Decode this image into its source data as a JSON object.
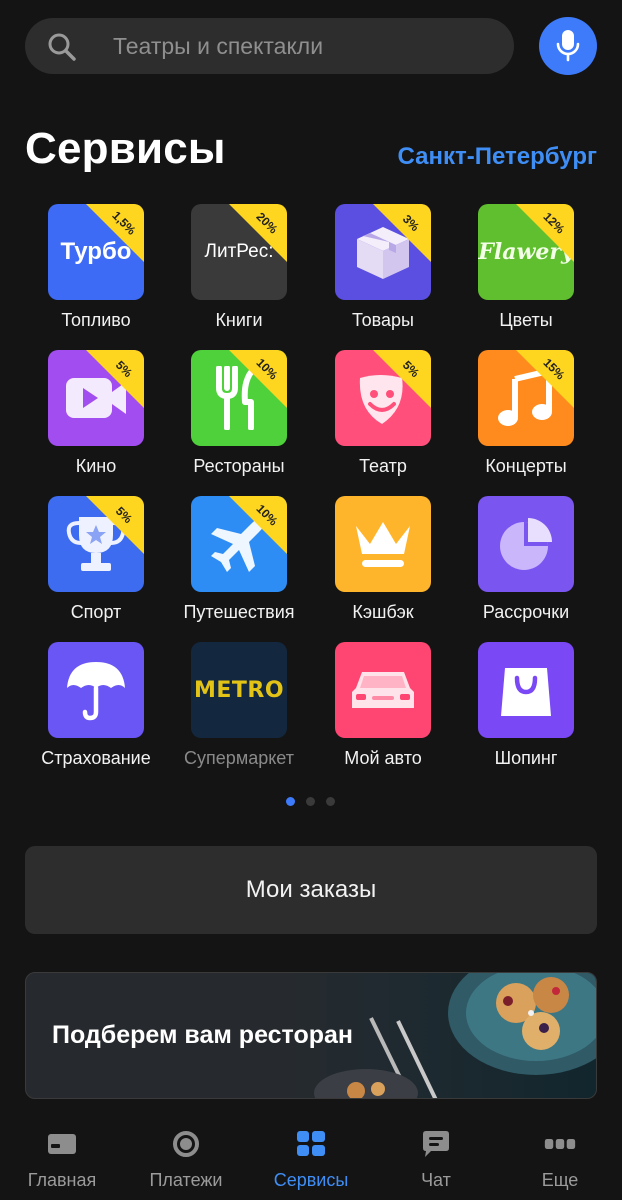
{
  "search": {
    "placeholder": "Театры и спектакли"
  },
  "header": {
    "title": "Сервисы",
    "city": "Санкт-Петербург"
  },
  "services": [
    {
      "label": "Топливо",
      "badge": "1,5%",
      "logo": "Турбо",
      "icon": "turbo-logo-icon",
      "color": "#3e6bf5"
    },
    {
      "label": "Книги",
      "badge": "20%",
      "logo": "ЛитРес:",
      "icon": "litres-logo-icon",
      "color": "#3a3a3a"
    },
    {
      "label": "Товары",
      "badge": "3%",
      "icon": "box-icon",
      "color": "#5a4fe0"
    },
    {
      "label": "Цветы",
      "badge": "12%",
      "logo": "Flawery",
      "icon": "flawery-logo-icon",
      "color": "#5fbf2f"
    },
    {
      "label": "Кино",
      "badge": "5%",
      "icon": "video-camera-icon",
      "color": "#a24df0"
    },
    {
      "label": "Рестораны",
      "badge": "10%",
      "icon": "fork-knife-icon",
      "color": "#4fd13b"
    },
    {
      "label": "Театр",
      "badge": "5%",
      "icon": "theatre-mask-icon",
      "color": "#ff4f7a"
    },
    {
      "label": "Концерты",
      "badge": "15%",
      "icon": "music-note-icon",
      "color": "#ff8a1e"
    },
    {
      "label": "Спорт",
      "badge": "5%",
      "icon": "trophy-icon",
      "color": "#3d6cf0"
    },
    {
      "label": "Путешествия",
      "badge": "10%",
      "icon": "airplane-icon",
      "color": "#2e8df5"
    },
    {
      "label": "Кэшбэк",
      "badge": "",
      "icon": "crown-icon",
      "color": "#ffb52b"
    },
    {
      "label": "Рассрочки",
      "badge": "",
      "icon": "pie-chart-icon",
      "color": "#7a55f0"
    },
    {
      "label": "Страхование",
      "badge": "",
      "icon": "umbrella-icon",
      "color": "#6a55f5"
    },
    {
      "label": "Супермаркет",
      "badge": "",
      "logo": "METRO",
      "icon": "metro-logo-icon",
      "color": "#13283f",
      "dimmed": true
    },
    {
      "label": "Мой авто",
      "badge": "",
      "icon": "car-icon",
      "color": "#ff4572"
    },
    {
      "label": "Шопинг",
      "badge": "",
      "icon": "shopping-bag-icon",
      "color": "#7a48f5"
    }
  ],
  "pagination": {
    "pages": 3,
    "active": 1
  },
  "orders": {
    "label": "Мои заказы"
  },
  "promo": {
    "title": "Подберем вам ресторан"
  },
  "nav": [
    {
      "label": "Главная",
      "icon": "home-card-icon",
      "active": false
    },
    {
      "label": "Платежи",
      "icon": "payments-circle-icon",
      "active": false
    },
    {
      "label": "Сервисы",
      "icon": "services-grid-icon",
      "active": true
    },
    {
      "label": "Чат",
      "icon": "chat-icon",
      "active": false
    },
    {
      "label": "Еще",
      "icon": "more-dots-icon",
      "active": false
    }
  ],
  "colors": {
    "accent": "#3e7bfa",
    "link": "#3f8ef5",
    "badge": "#ffd61f",
    "background": "#141414"
  }
}
